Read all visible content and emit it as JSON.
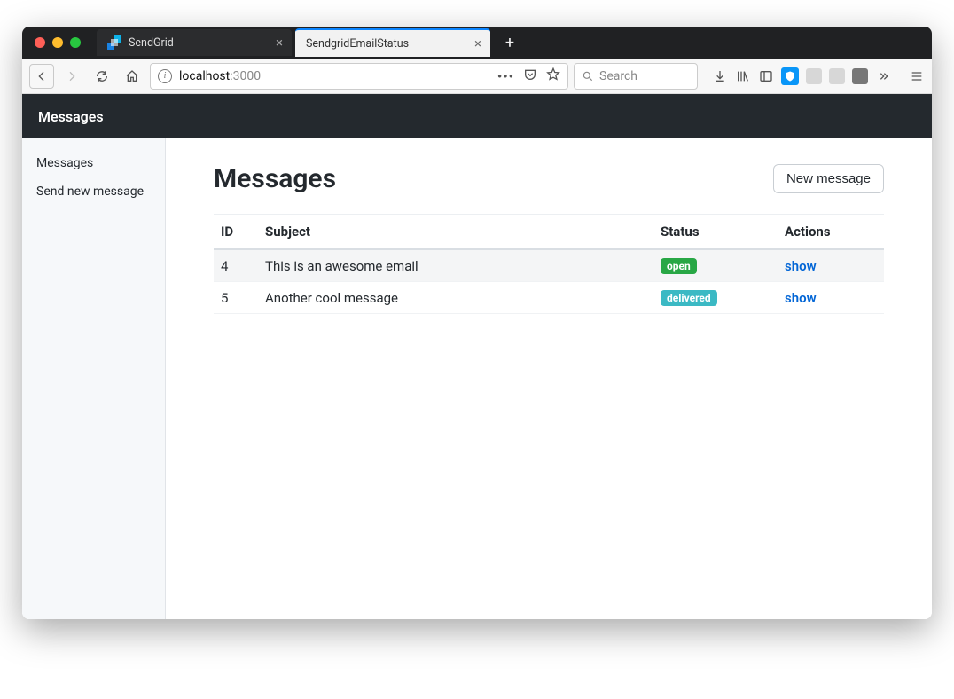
{
  "browser": {
    "tabs": [
      {
        "title": "SendGrid",
        "active": false
      },
      {
        "title": "SendgridEmailStatus",
        "active": true
      }
    ],
    "url_host": "localhost",
    "url_rest": ":3000",
    "search_placeholder": "Search"
  },
  "app": {
    "header_title": "Messages",
    "sidebar": {
      "items": [
        {
          "label": "Messages"
        },
        {
          "label": "Send new message"
        }
      ]
    },
    "main": {
      "title": "Messages",
      "new_button": "New message",
      "table": {
        "columns": {
          "id": "ID",
          "subject": "Subject",
          "status": "Status",
          "actions": "Actions"
        },
        "rows": [
          {
            "id": "4",
            "subject": "This is an awesome email",
            "status": "open",
            "status_class": "open",
            "action": "show"
          },
          {
            "id": "5",
            "subject": "Another cool message",
            "status": "delivered",
            "status_class": "delivered",
            "action": "show"
          }
        ]
      }
    }
  }
}
